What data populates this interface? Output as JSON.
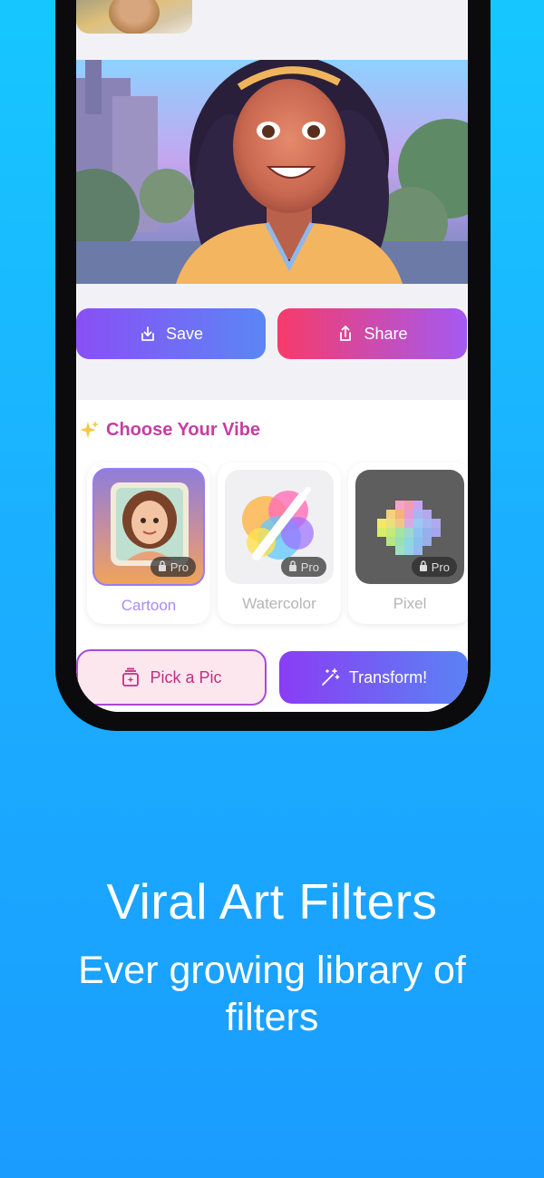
{
  "screen": {
    "actions": {
      "save_label": "Save",
      "share_label": "Share"
    },
    "vibe": {
      "title": "Choose Your Vibe",
      "sparkle_icon": "sparkles-icon",
      "filters": [
        {
          "label": "Cartoon",
          "badge": "Pro",
          "selected": true
        },
        {
          "label": "Watercolor",
          "badge": "Pro",
          "selected": false
        },
        {
          "label": "Pixel",
          "badge": "Pro",
          "selected": false
        }
      ]
    },
    "bottom_actions": {
      "pick_label": "Pick a Pic",
      "transform_label": "Transform!"
    }
  },
  "promo": {
    "headline": "Viral Art Filters",
    "subline": "Ever growing library of filters"
  },
  "colors": {
    "background": "#1bb0ff",
    "save_gradient_start": "#8a4ff5",
    "share_gradient_start": "#f63b6a",
    "vibe_title": "#c63da2",
    "selected_label": "#a98cf3"
  }
}
